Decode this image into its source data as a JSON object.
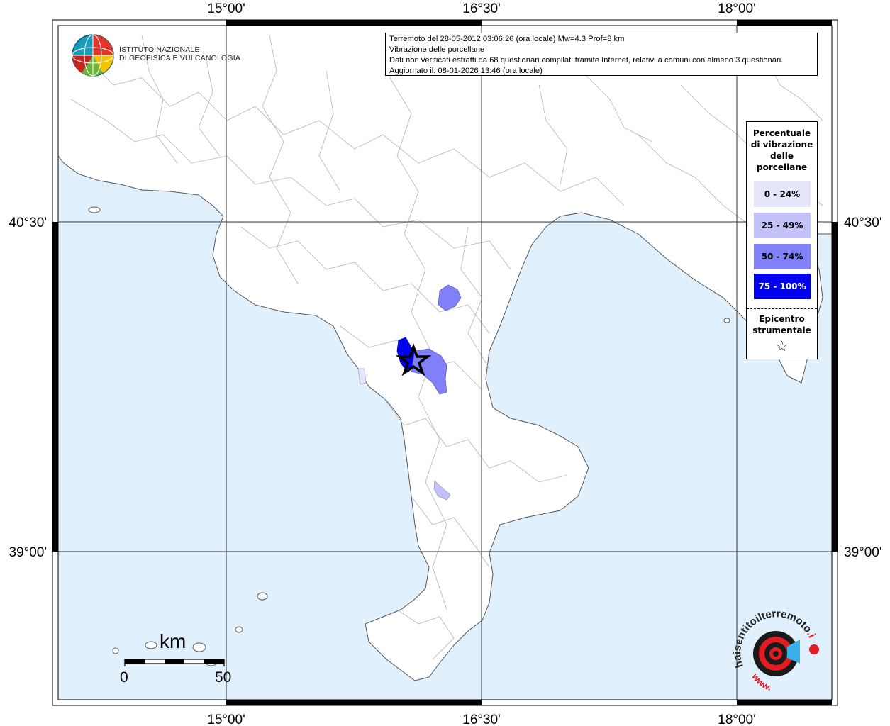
{
  "header": {
    "line1": "Terremoto del 28-05-2012 03:06:26 (ora locale) Mw=4.3 Prof=8 km",
    "line2": "Vibrazione delle porcellane",
    "line3": "Dati non verificati estratti da 68 questionari compilati tramite Internet, relativi a comuni con almeno 3 questionari.",
    "line4": "Aggiornato il: 08-01-2026 13:46 (ora locale)"
  },
  "logo": {
    "line1": "ISTITUTO NAZIONALE",
    "line2": "DI GEOFISICA E VULCANOLOGIA",
    "icon": "ingv-globe-icon"
  },
  "axes": {
    "top_labels": [
      "15°00'",
      "16°30'",
      "18°00'"
    ],
    "bottom_labels": [
      "15°00'",
      "16°30'",
      "18°00'"
    ],
    "left_labels": [
      "40°30'",
      "39°00'"
    ],
    "right_labels": [
      "40°30'",
      "39°00'"
    ]
  },
  "legend": {
    "title_lines": [
      "Percentuale",
      "di vibrazione",
      "delle",
      "porcellane"
    ],
    "classes": [
      {
        "label": "0 - 24%",
        "color": "#e6e6fa",
        "text_color": "#000000"
      },
      {
        "label": "25 - 49%",
        "color": "#c3c3fa",
        "text_color": "#000000"
      },
      {
        "label": "50 - 74%",
        "color": "#8080f8",
        "text_color": "#000000"
      },
      {
        "label": "75 - 100%",
        "color": "#0000f0",
        "text_color": "#ffffff"
      }
    ],
    "epicenter_lines": [
      "Epicentro",
      "strumentale"
    ],
    "epicenter_symbol": "☆"
  },
  "scale_bar": {
    "unit": "km",
    "start": "0",
    "end": "50"
  },
  "hs_logo": {
    "text_prefix": "haisentito",
    "text_main": "ilterremoto",
    "text_tld": ".it",
    "text_bottom": "www.",
    "icon": "hai-sentito-target-icon"
  },
  "colors": {
    "sea": "#e0f0fc",
    "land": "#ffffff",
    "border": "#9a9a9a",
    "grid": "#333333"
  }
}
